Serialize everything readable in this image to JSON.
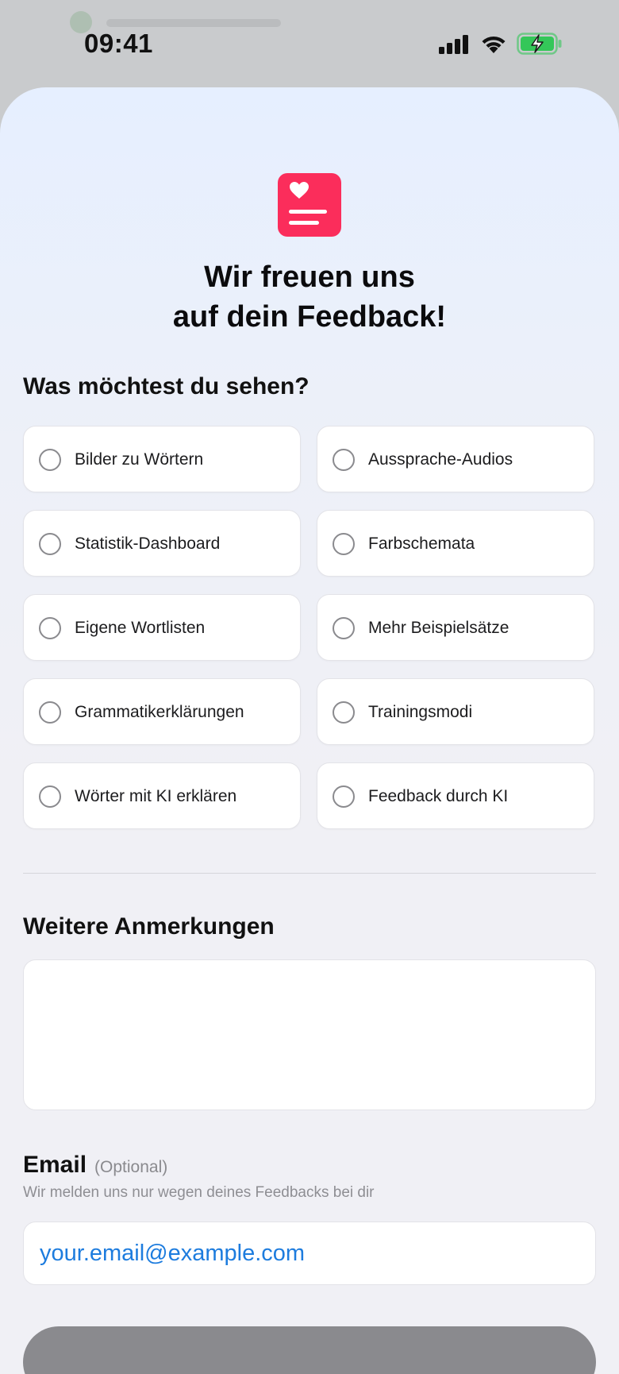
{
  "status_bar": {
    "time": "09:41",
    "battery_color": "#34c759"
  },
  "header": {
    "icon": "feedback-heart-icon",
    "icon_color": "#fb2d5b",
    "title_line1": "Wir freuen uns",
    "title_line2": "auf dein Feedback!"
  },
  "features": {
    "title": "Was möchtest du sehen?",
    "options": [
      {
        "label": "Bilder zu Wörtern",
        "selected": false
      },
      {
        "label": "Aussprache-Audios",
        "selected": false
      },
      {
        "label": "Statistik-Dashboard",
        "selected": false
      },
      {
        "label": "Farbschemata",
        "selected": false
      },
      {
        "label": "Eigene Wortlisten",
        "selected": false
      },
      {
        "label": "Mehr Beispielsätze",
        "selected": false
      },
      {
        "label": "Grammatikerklärungen",
        "selected": false
      },
      {
        "label": "Trainingsmodi",
        "selected": false
      },
      {
        "label": "Wörter mit KI erklären",
        "selected": false
      },
      {
        "label": "Feedback durch KI",
        "selected": false
      }
    ]
  },
  "notes": {
    "title": "Weitere Anmerkungen",
    "value": ""
  },
  "email": {
    "title": "Email",
    "optional_tag": "(Optional)",
    "hint": "Wir melden uns nur wegen deines Feedbacks bei dir",
    "placeholder": "your.email@example.com",
    "value": ""
  },
  "colors": {
    "accent_link": "#1d7cde",
    "submit_disabled": "#8a8a8e"
  }
}
